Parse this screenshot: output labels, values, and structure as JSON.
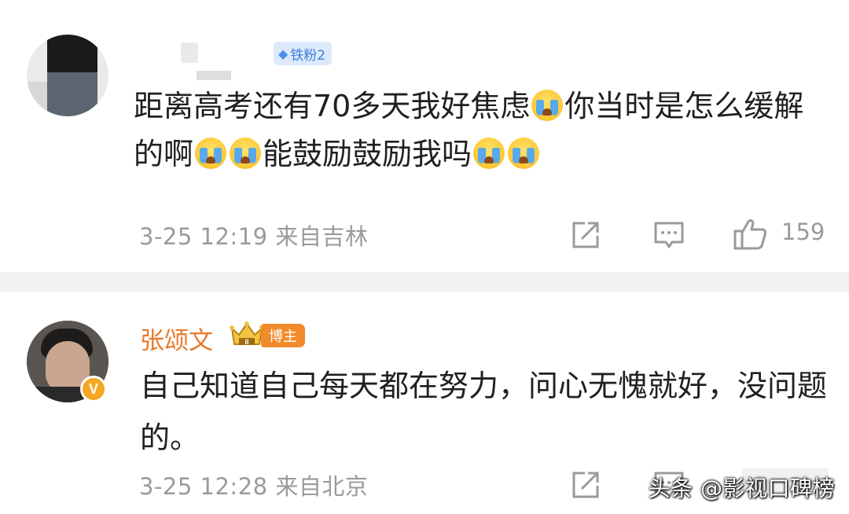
{
  "comment1": {
    "user_badge": "铁粉2",
    "segments": [
      {
        "type": "text",
        "value": "距离高考还有70多天我好焦虑"
      },
      {
        "type": "emoji",
        "name": "cry-emoji"
      },
      {
        "type": "text",
        "value": "你当时是怎么缓解的啊"
      },
      {
        "type": "emoji",
        "name": "cry-emoji"
      },
      {
        "type": "emoji",
        "name": "cry-emoji"
      },
      {
        "type": "text",
        "value": "能鼓励鼓励我吗"
      },
      {
        "type": "emoji",
        "name": "cry-emoji"
      },
      {
        "type": "emoji",
        "name": "cry-emoji"
      }
    ],
    "meta": "3-25 12:19 来自吉林",
    "likes": "159"
  },
  "comment2": {
    "username": "张颂文",
    "badge": "博主",
    "crown_level": "II",
    "avatar_badge": "V",
    "text": "自己知道自己每天都在努力，问心无愧就好，没问题的。",
    "meta": "3-25 12:28 来自北京"
  },
  "watermark": "头条 @影视口碑榜",
  "icons": {
    "share": "share-icon",
    "comment": "comment-icon",
    "like": "thumbs-up-icon",
    "crown": "crown-icon",
    "fan": "diamond-icon"
  },
  "colors": {
    "username_orange": "#e87a2a",
    "badge_orange": "#f18a2b",
    "fan_badge_bg": "#dbe9fb",
    "fan_badge_text": "#3e7fd8",
    "meta_gray": "#9a9a9a",
    "divider": "#f2f2f2"
  }
}
